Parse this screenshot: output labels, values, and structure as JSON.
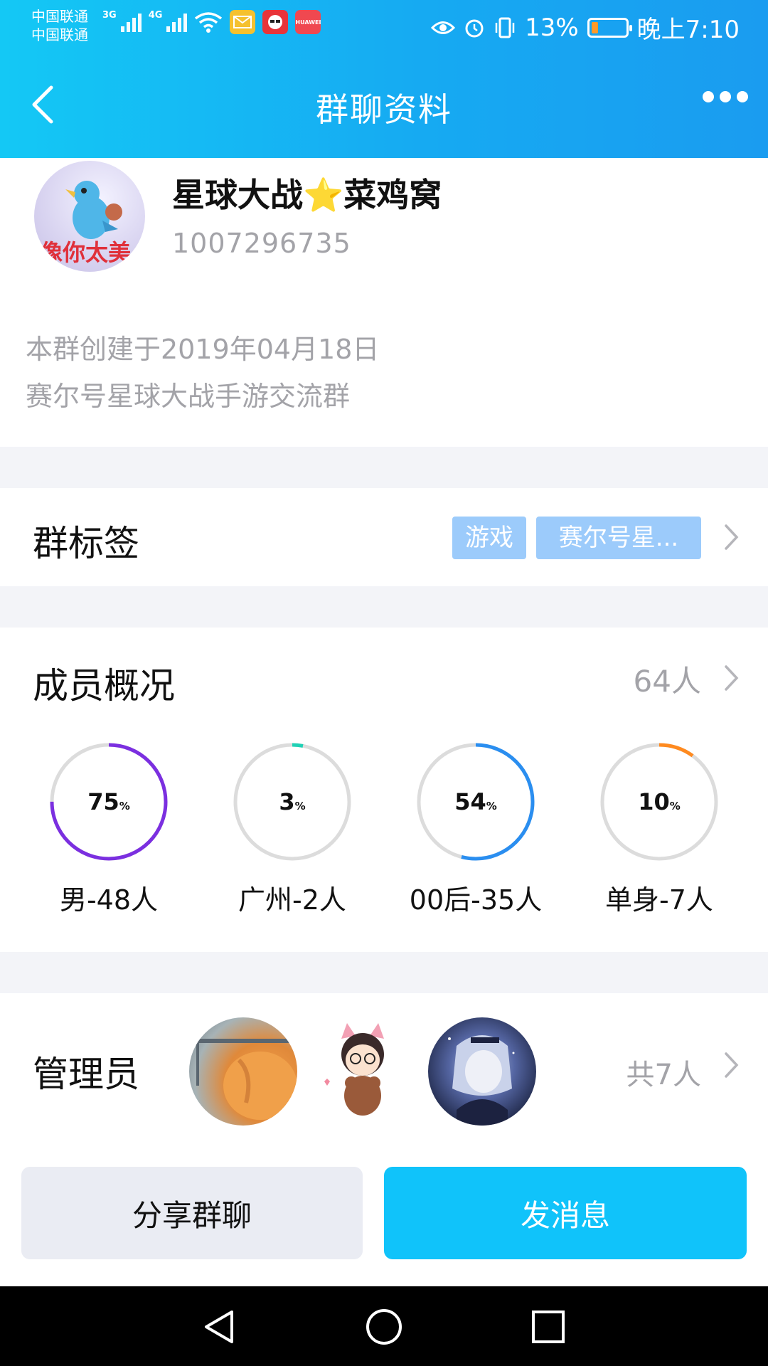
{
  "status_bar": {
    "carrier_line1": "中国联通",
    "carrier_line2": "中国联通",
    "net1": "3G",
    "net2": "4G",
    "app_icon_label": "HUAWEI",
    "battery_text": "13%",
    "time": "晚上7:10",
    "battery_color": "#ff9a2a"
  },
  "nav": {
    "title": "群聊资料"
  },
  "group": {
    "name": "星球大战⭐菜鸡窝",
    "id": "1007296735",
    "avatar_text": "像你太美",
    "desc_line1": "本群创建于2019年04月18日",
    "desc_line2": "赛尔号星球大战手游交流群"
  },
  "tags": {
    "title": "群标签",
    "items": [
      "游戏",
      "赛尔号星..."
    ]
  },
  "members": {
    "title": "成员概况",
    "count": "64人",
    "stats": [
      {
        "percent": 75,
        "percent_text": "75",
        "unit": "%",
        "label": "男-48人",
        "color": "#7b2fe0"
      },
      {
        "percent": 3,
        "percent_text": "3",
        "unit": "%",
        "label": "广州-2人",
        "color": "#1fd1b5"
      },
      {
        "percent": 54,
        "percent_text": "54",
        "unit": "%",
        "label": "00后-35人",
        "color": "#2a8ef0"
      },
      {
        "percent": 10,
        "percent_text": "10",
        "unit": "%",
        "label": "单身-7人",
        "color": "#ff8a1f"
      }
    ]
  },
  "admins": {
    "title": "管理员",
    "count": "共7人"
  },
  "actions": {
    "share": "分享群聊",
    "send": "发消息"
  },
  "colors": {
    "header_start": "#14c8f5",
    "header_end": "#1a9cf0",
    "send_button": "#10c3fa",
    "tag_bg": "#9ccbfb"
  }
}
